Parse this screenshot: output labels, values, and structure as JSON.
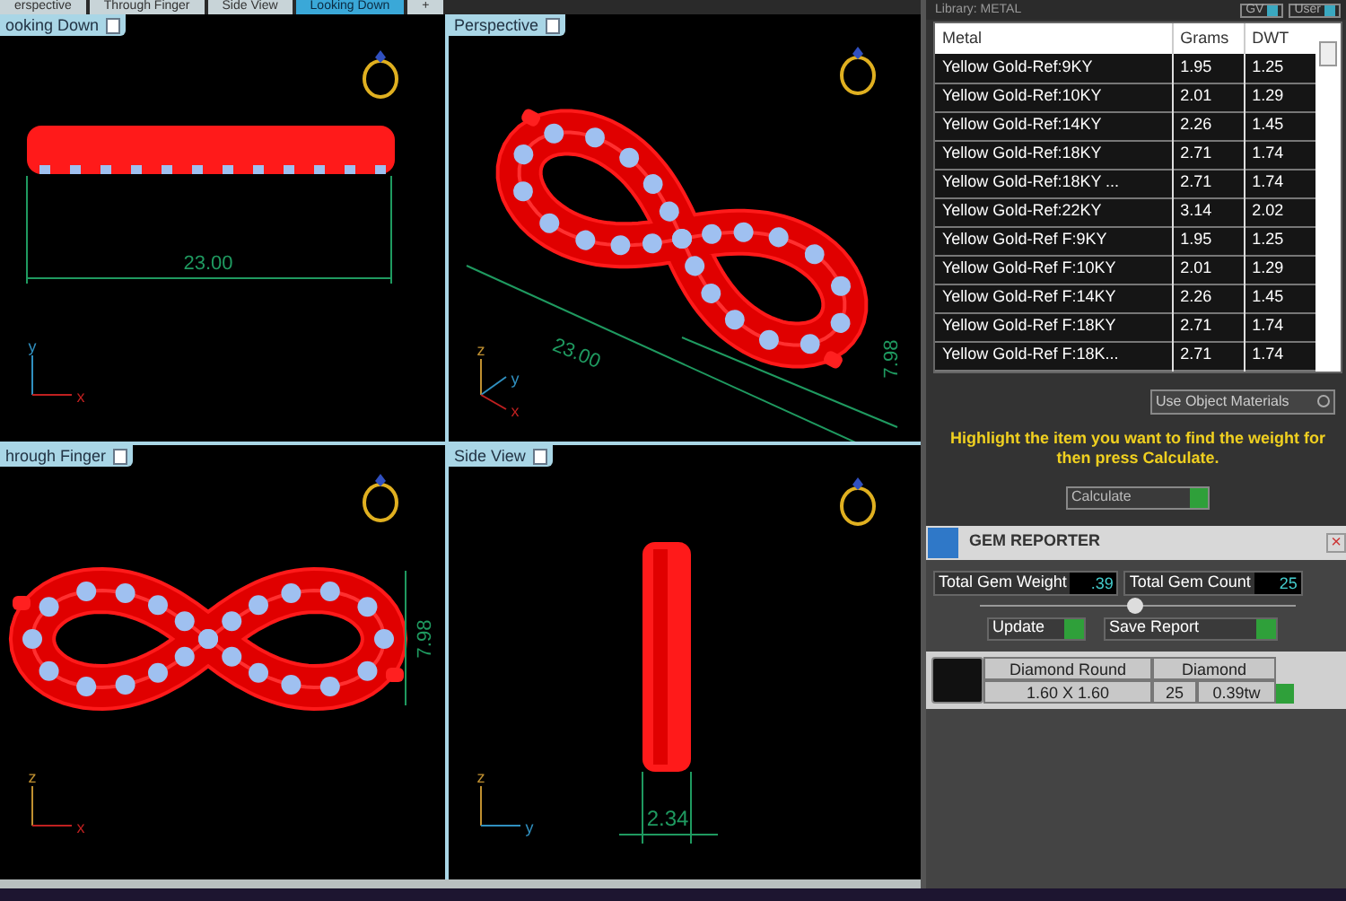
{
  "tabs": [
    {
      "label": "erspective",
      "selected": false
    },
    {
      "label": "Through Finger",
      "selected": false
    },
    {
      "label": "Side View",
      "selected": false
    },
    {
      "label": "Looking Down",
      "selected": true
    },
    {
      "label": "+",
      "selected": false
    }
  ],
  "viewports": [
    {
      "label": "ooking Down",
      "kind": "bar",
      "dims": [
        "23.00"
      ],
      "axes": [
        "y",
        "x"
      ]
    },
    {
      "label": "Perspective",
      "kind": "perspective",
      "dims": [
        "23.00",
        "7.98"
      ],
      "axes": [
        "z",
        "y",
        "x"
      ]
    },
    {
      "label": "hrough Finger",
      "kind": "flat",
      "dims": [
        "7.98"
      ],
      "axes": [
        "z",
        "x"
      ]
    },
    {
      "label": "Side View",
      "kind": "side",
      "dims": [
        "2.34"
      ],
      "axes": [
        "z",
        "y"
      ]
    }
  ],
  "library": {
    "title": "Library: METAL",
    "toggles": [
      "GV",
      "User"
    ],
    "columns": [
      "Metal",
      "Grams",
      "DWT"
    ],
    "rows": [
      [
        "Yellow Gold-Ref:9KY",
        "1.95",
        "1.25"
      ],
      [
        "Yellow Gold-Ref:10KY",
        "2.01",
        "1.29"
      ],
      [
        "Yellow Gold-Ref:14KY",
        "2.26",
        "1.45"
      ],
      [
        "Yellow Gold-Ref:18KY",
        "2.71",
        "1.74"
      ],
      [
        "Yellow Gold-Ref:18KY ...",
        "2.71",
        "1.74"
      ],
      [
        "Yellow Gold-Ref:22KY",
        "3.14",
        "2.02"
      ],
      [
        "Yellow Gold-Ref F:9KY",
        "1.95",
        "1.25"
      ],
      [
        "Yellow Gold-Ref F:10KY",
        "2.01",
        "1.29"
      ],
      [
        "Yellow Gold-Ref F:14KY",
        "2.26",
        "1.45"
      ],
      [
        "Yellow Gold-Ref F:18KY",
        "2.71",
        "1.74"
      ],
      [
        "Yellow Gold-Ref F:18K...",
        "2.71",
        "1.74"
      ]
    ],
    "use_object_materials": "Use Object Materials",
    "message": "Highlight the item you want to find the weight for then press Calculate.",
    "calculate": "Calculate"
  },
  "gem_reporter": {
    "title": "GEM REPORTER",
    "close": "×",
    "weight_label": "Total Gem Weight",
    "weight": ".39",
    "count_label": "Total Gem Count",
    "count": "25",
    "update": "Update",
    "save": "Save Report",
    "gems": [
      {
        "name": "Diamond Round",
        "type": "Diamond",
        "size": "1.60 X 1.60",
        "count": "25",
        "weight": "0.39tw"
      }
    ]
  }
}
